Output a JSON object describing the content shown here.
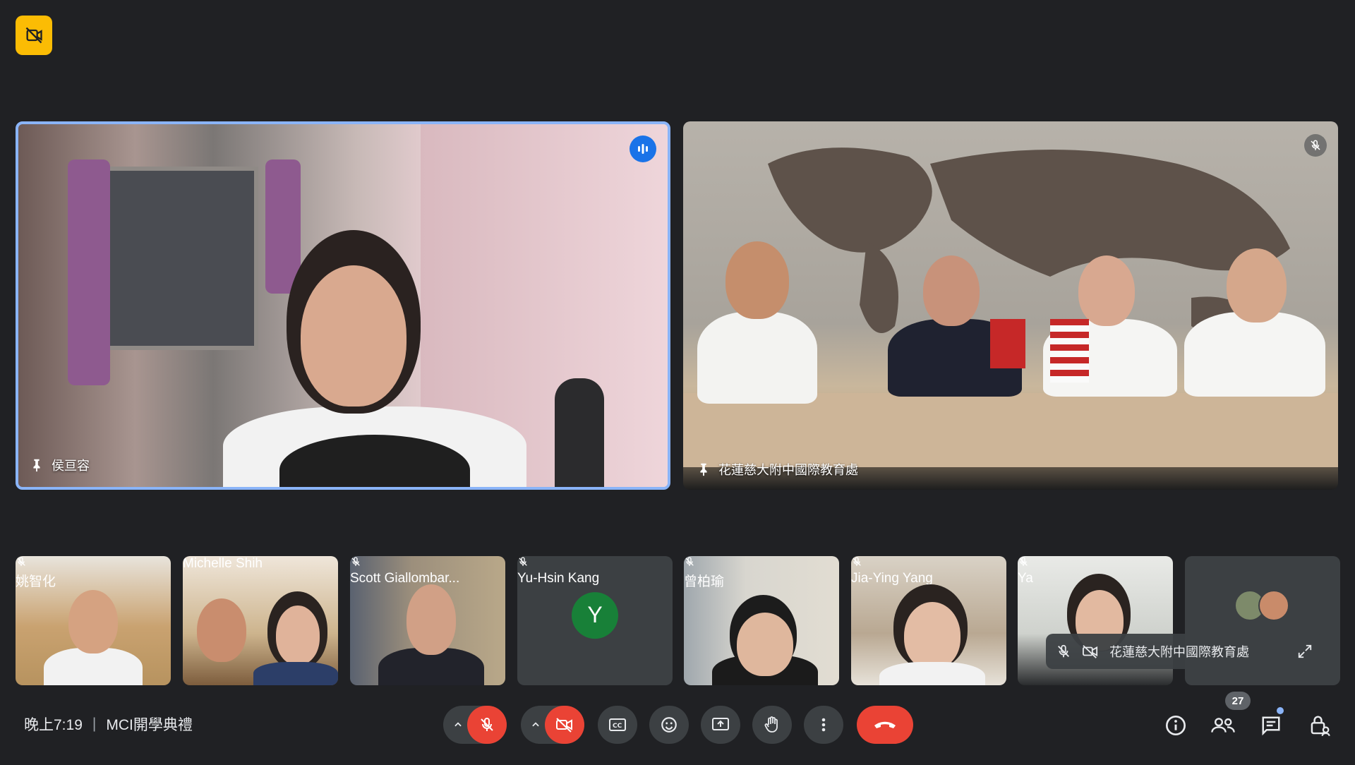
{
  "meeting": {
    "time": "晚上7:19",
    "separator": "|",
    "title": "MCI開學典禮",
    "participant_count": "27"
  },
  "main_tiles": [
    {
      "name": "侯亘容",
      "speaking": true,
      "pinned_icon": true
    },
    {
      "name": "花蓮慈大附中國際教育處",
      "muted": true,
      "pinned": true
    }
  ],
  "strip_tiles": [
    {
      "name": "姚智化",
      "muted": true
    },
    {
      "name": "Michelle Shih",
      "muted": false
    },
    {
      "name": "Scott Giallombar...",
      "muted": true
    },
    {
      "name": "Yu-Hsin Kang",
      "muted": true,
      "avatar_letter": "Y",
      "avatar_color": "#188038"
    },
    {
      "name": "曾柏瑜",
      "muted": true
    },
    {
      "name": "Jia-Ying Yang",
      "muted": true
    },
    {
      "name": "Ya",
      "muted": true
    },
    {
      "name": "",
      "overflow": true
    }
  ],
  "floating_self_view": {
    "name": "花蓮慈大附中國際教育處"
  },
  "colors": {
    "background": "#202124",
    "surface": "#3c4043",
    "accent_blue": "#8ab4f8",
    "danger_red": "#ea4335",
    "warning_yellow": "#fbbc04"
  }
}
